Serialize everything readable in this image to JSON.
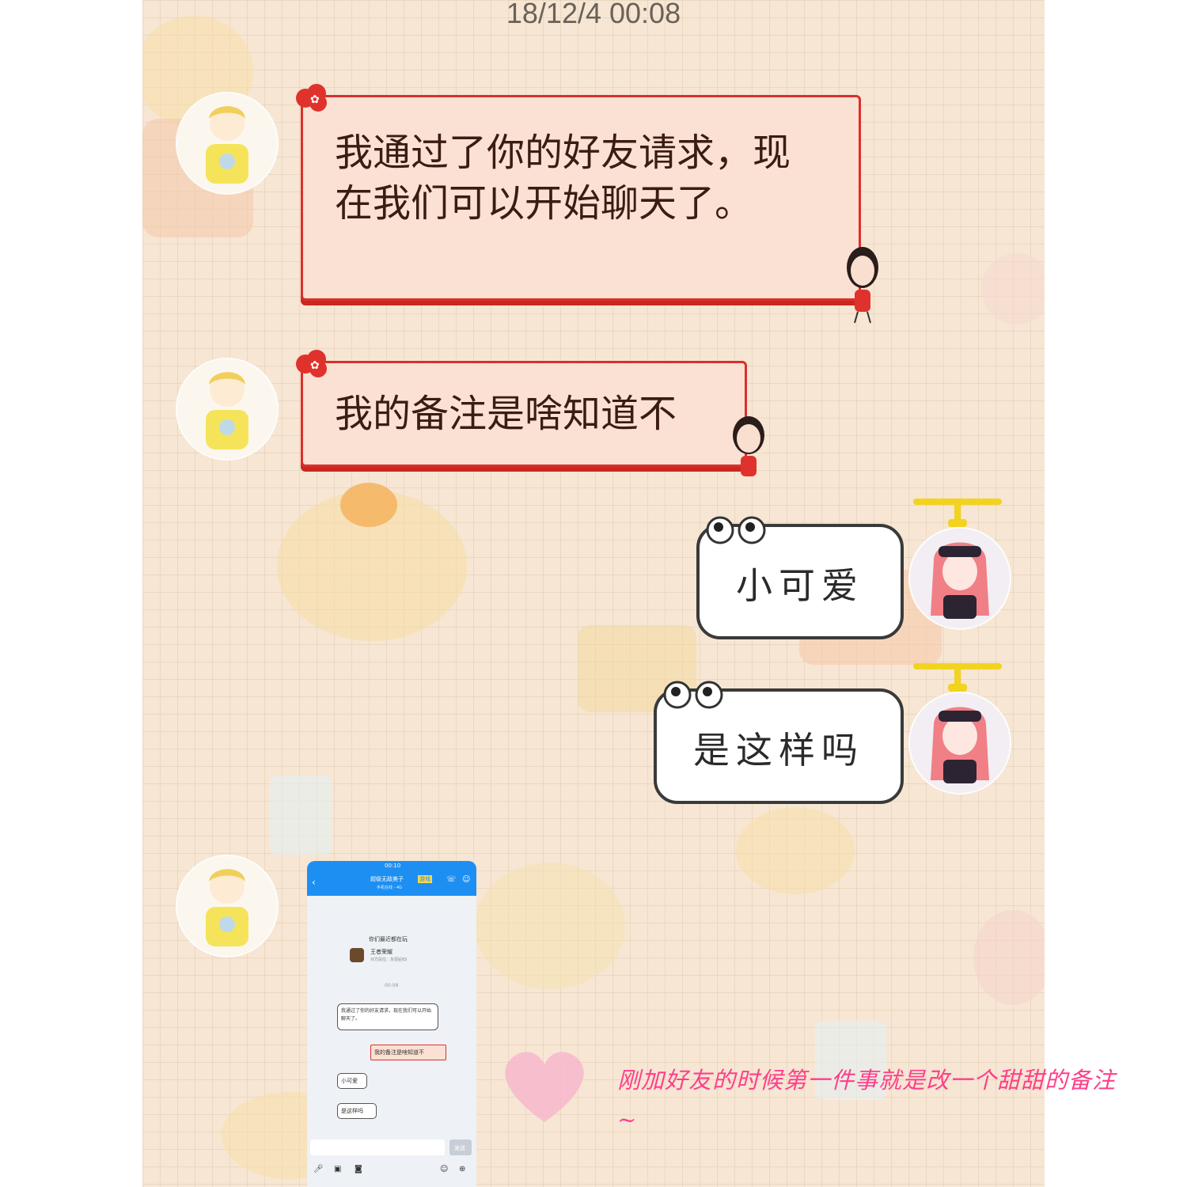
{
  "chat": {
    "timestamp": "18/12/4 00:08",
    "messages": [
      {
        "side": "left",
        "text": "我通过了你的好友请求，现在我们可以开始聊天了。"
      },
      {
        "side": "left",
        "text": "我的备注是啥知道不"
      },
      {
        "side": "right",
        "text": "小可爱"
      },
      {
        "side": "right",
        "text": "是这样吗"
      }
    ]
  },
  "screenshot": {
    "status_time": "00:10",
    "contact_name": "超级无敌美子",
    "contact_tag": "游戏",
    "sub_status": "手机在线 - 4G",
    "section_title": "你们最近都在玩",
    "game_name": "王者荣耀",
    "game_desc": "对方段位：永恒钻石I",
    "msg_time": "00:08",
    "msg1": "我通过了你的好友请求，现在我们可以开始聊天了。",
    "msg2": "我的备注是啥知道不",
    "msg3": "小可爱",
    "msg4": "是这样吗",
    "send_label": "发送"
  },
  "caption": "刚加好友的时候第一件事就是改一个甜甜的备注~",
  "colors": {
    "background": "#f6e6d3",
    "bubble_red_border": "#d9302c",
    "bubble_red_fill": "#fbe1d3",
    "caption": "#ff3f8a",
    "phone_header": "#1d8ff2"
  },
  "icons": [
    "male-avatar-icon",
    "female-avatar-icon",
    "flower-icon",
    "propeller-icon",
    "eyes-icon",
    "heart-icon"
  ]
}
